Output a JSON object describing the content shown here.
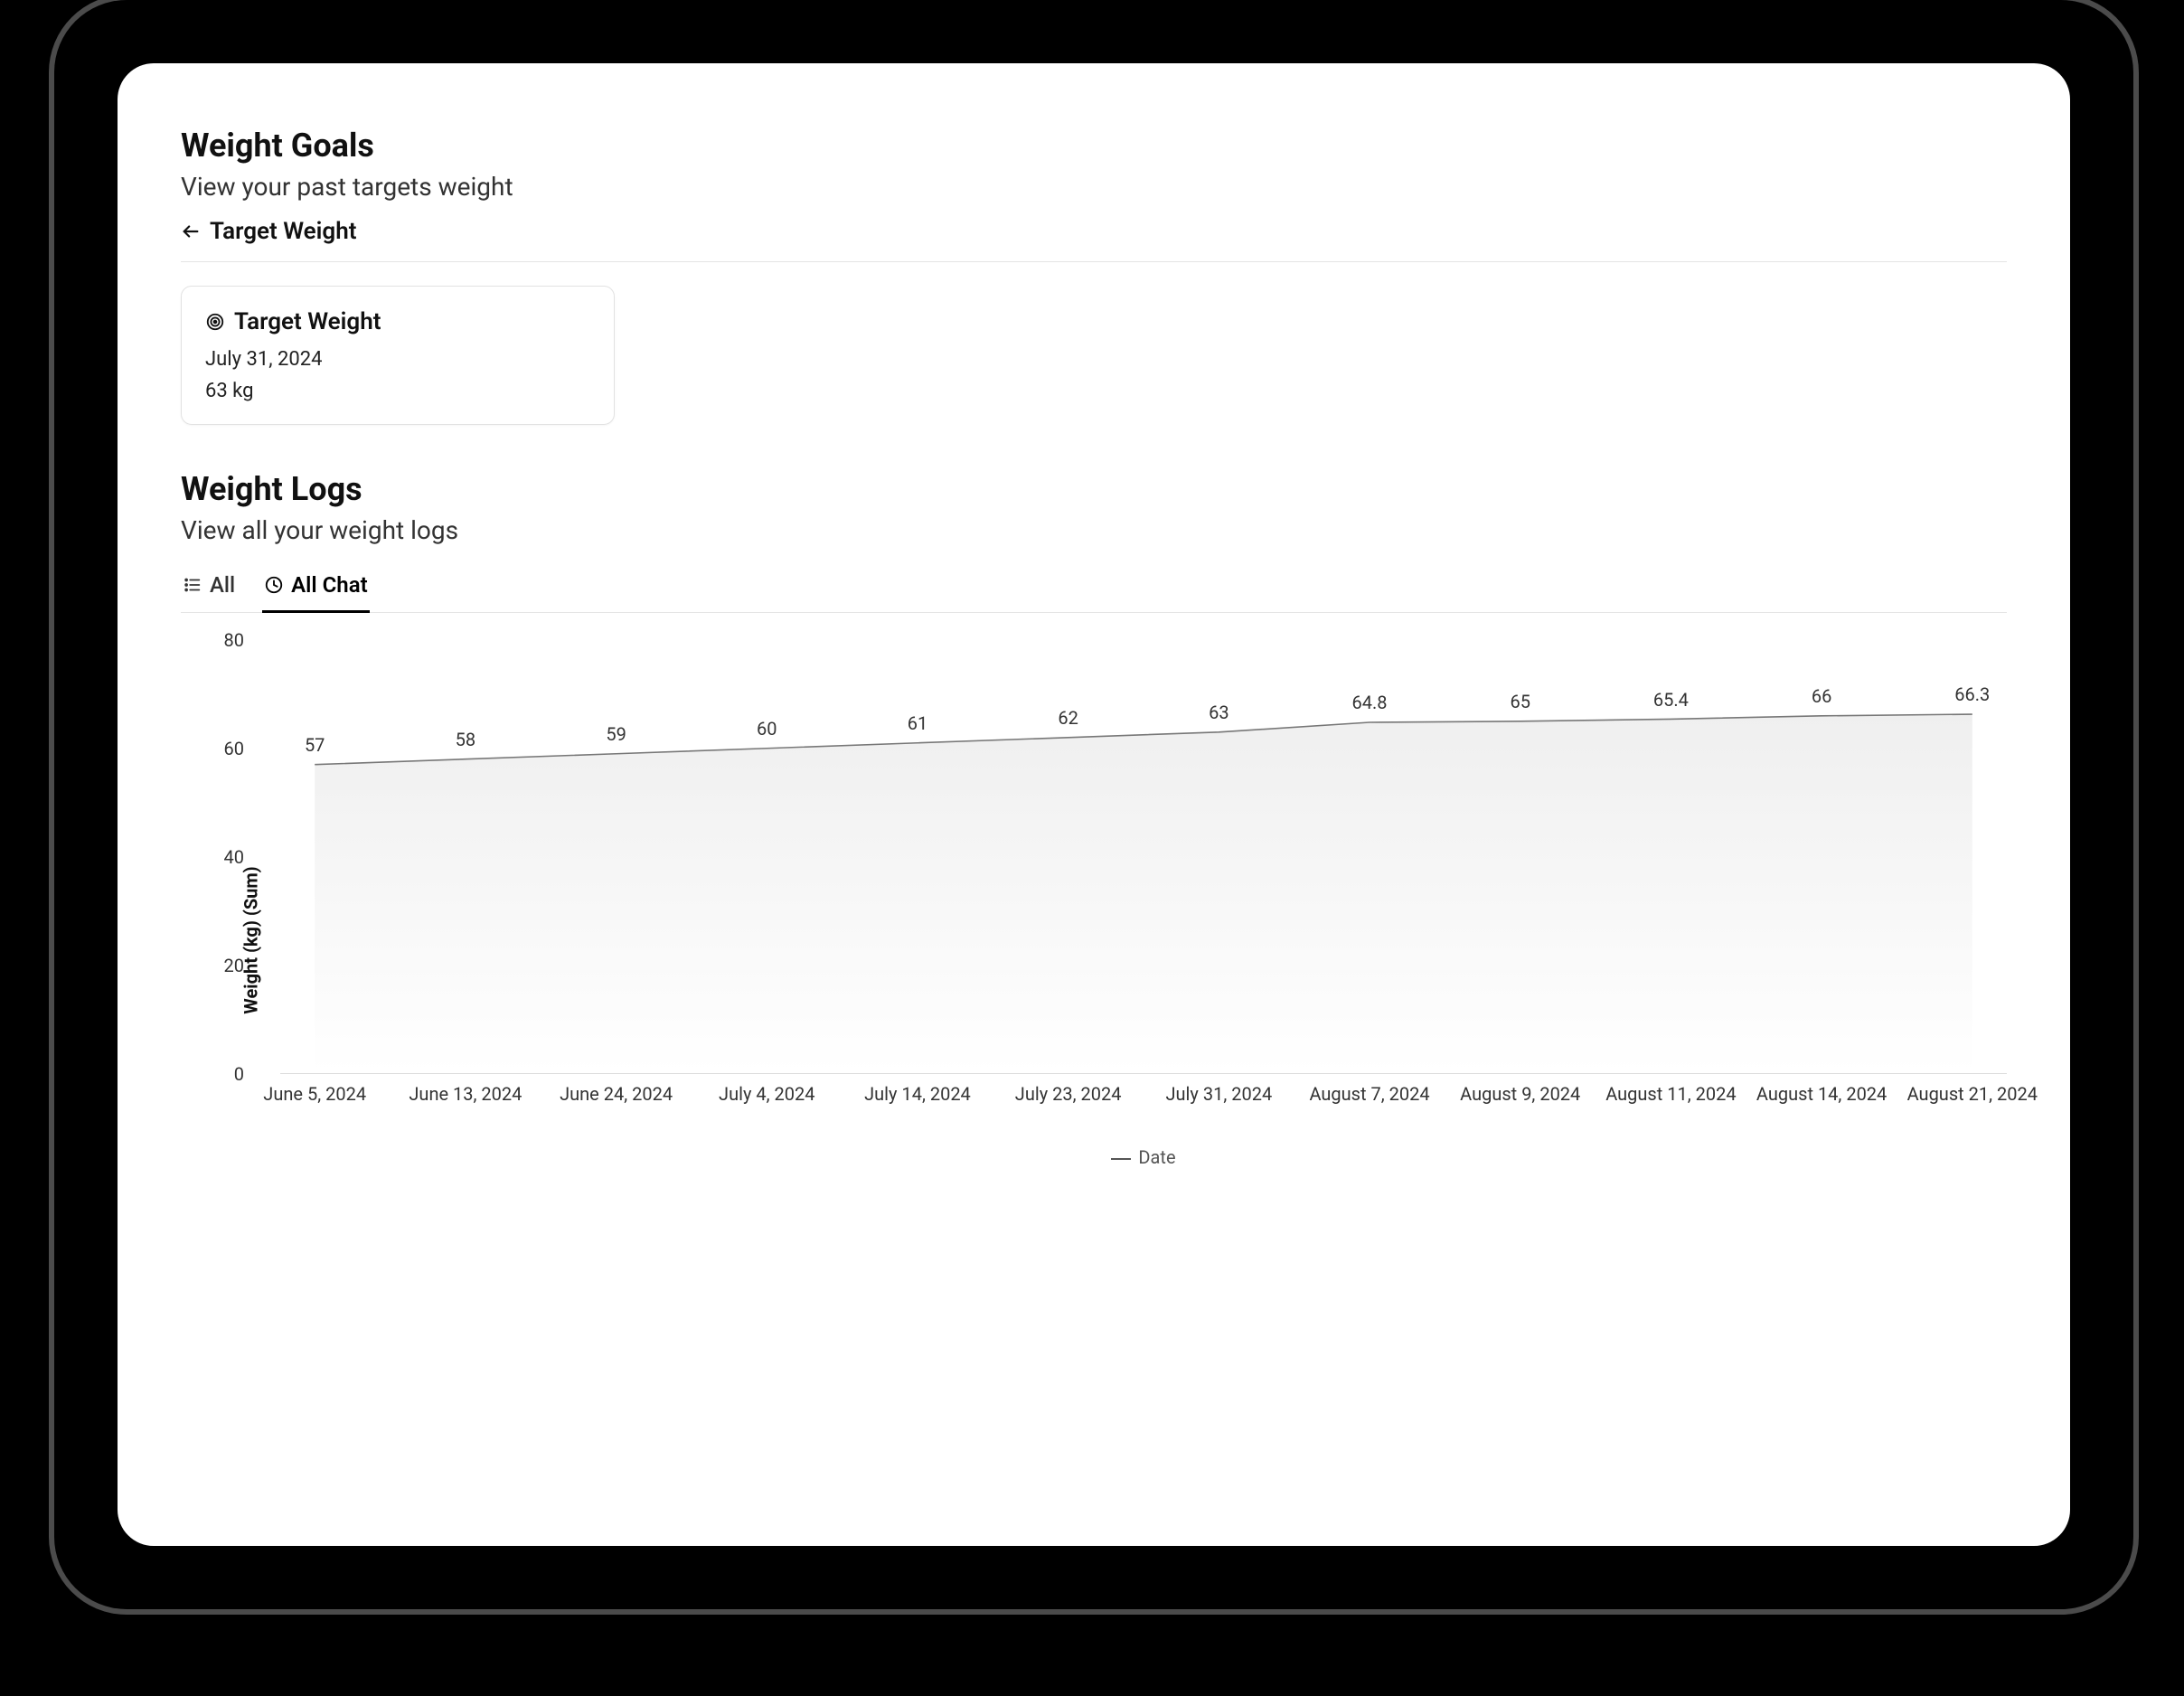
{
  "goals": {
    "title": "Weight Goals",
    "subtitle": "View your past targets weight",
    "back_label": "Target Weight",
    "card": {
      "title": "Target Weight",
      "date": "July 31, 2024",
      "value": "63 kg"
    }
  },
  "logs": {
    "title": "Weight Logs",
    "subtitle": "View all your weight logs",
    "tabs": {
      "all": "All",
      "all_chat": "All Chat"
    }
  },
  "chart_data": {
    "type": "area",
    "title": "",
    "xlabel": "Date",
    "ylabel": "Weight (kg) (Sum)",
    "ylim": [
      0,
      80
    ],
    "yticks": [
      0,
      20,
      40,
      60,
      80
    ],
    "categories": [
      "June 5, 2024",
      "June 13, 2024",
      "June 24, 2024",
      "July 4, 2024",
      "July 14, 2024",
      "July 23, 2024",
      "July 31, 2024",
      "August 7, 2024",
      "August 9, 2024",
      "August 11, 2024",
      "August 14, 2024",
      "August 21, 2024"
    ],
    "values": [
      57,
      58,
      59,
      60,
      61,
      62,
      63,
      64.8,
      65,
      65.4,
      66,
      66.3
    ],
    "legend": "Date"
  }
}
